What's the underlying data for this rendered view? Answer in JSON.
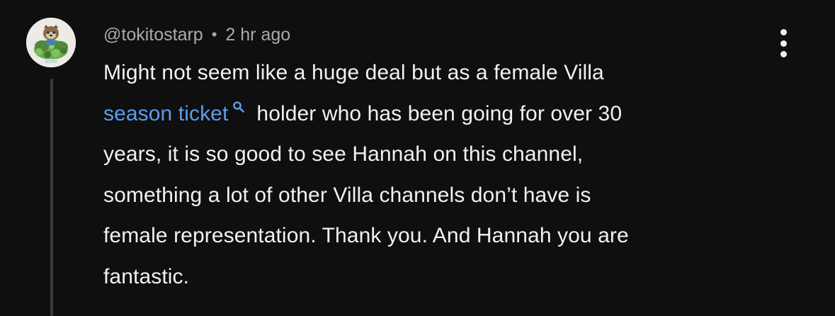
{
  "comment": {
    "username": "@tokitostarp",
    "separator": "•",
    "timestamp": "2 hr ago",
    "body": {
      "line1": "Might not seem like a huge deal but as a female Villa",
      "link_text": "season ticket",
      "line2_rest": "holder who has been going for over 30",
      "line3": "years, it is so good to see Hannah on this channel,",
      "line4": "something a lot of other Villa channels don’t have is",
      "line5": "female representation. Thank you. And Hannah you are",
      "line6": "fantastic."
    }
  },
  "icons": {
    "avatar": "avatar-illustration",
    "search": "search-icon",
    "more": "more-vertical-icon"
  },
  "colors": {
    "background": "#0f0f0f",
    "text": "#f1f1f1",
    "meta": "#aaaaaa",
    "link": "#5b9cf0",
    "thread_line": "#3a3a3a"
  }
}
